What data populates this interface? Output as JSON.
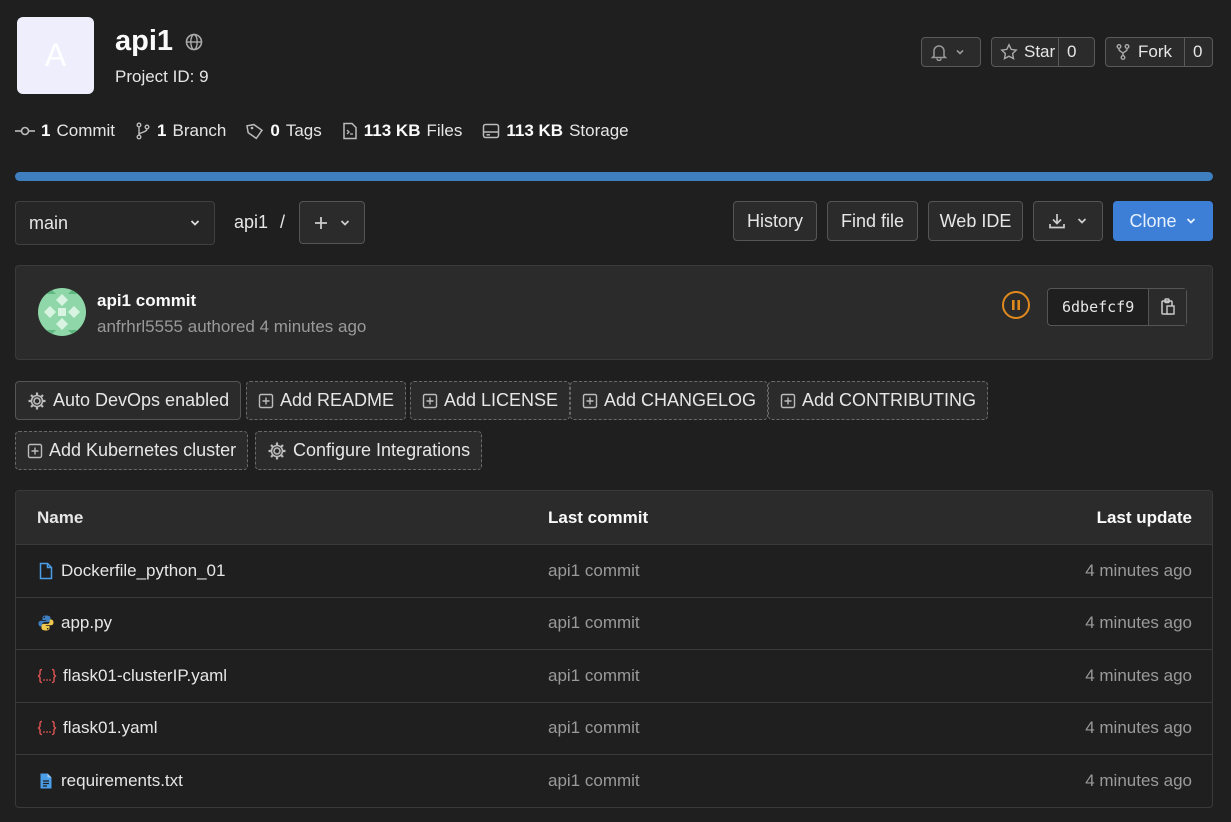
{
  "project": {
    "avatar_letter": "A",
    "name": "api1",
    "visibility_icon": "globe-icon",
    "project_id": "Project ID: 9"
  },
  "header_actions": {
    "notifications_icon": "bell-icon",
    "star_label": "Star",
    "star_count": "0",
    "fork_label": "Fork",
    "fork_count": "0"
  },
  "stats": [
    {
      "icon": "commit-icon",
      "value": "1",
      "label": "Commit"
    },
    {
      "icon": "branch-icon",
      "value": "1",
      "label": "Branch"
    },
    {
      "icon": "tag-icon",
      "value": "0",
      "label": "Tags"
    },
    {
      "icon": "file-icon",
      "value": "113 KB",
      "label": "Files"
    },
    {
      "icon": "storage-icon",
      "value": "113 KB",
      "label": "Storage"
    }
  ],
  "language_bar": {
    "color": "#3f7fbf",
    "fraction": 1.0
  },
  "toolbar": {
    "branch": "main",
    "breadcrumb_repo": "api1",
    "breadcrumb_sep": "/",
    "history_label": "History",
    "find_file_label": "Find file",
    "web_ide_label": "Web IDE",
    "clone_label": "Clone"
  },
  "last_commit": {
    "title": "api1 commit",
    "author": "anfrhrl5555",
    "authored_text": "authored 4 minutes ago",
    "pipeline_status": "paused",
    "sha": "6dbefcf9"
  },
  "quick_actions": [
    {
      "label": "Auto DevOps enabled",
      "icon": "gear-icon"
    },
    {
      "label": "Add README",
      "icon": "plus-square-icon"
    },
    {
      "label": "Add LICENSE",
      "icon": "plus-square-icon"
    },
    {
      "label": "Add CHANGELOG",
      "icon": "plus-square-icon"
    },
    {
      "label": "Add CONTRIBUTING",
      "icon": "plus-square-icon"
    },
    {
      "label": "Add Kubernetes cluster",
      "icon": "plus-square-icon"
    },
    {
      "label": "Configure Integrations",
      "icon": "gear-icon"
    }
  ],
  "file_table": {
    "headers": {
      "name": "Name",
      "last_commit": "Last commit",
      "last_update": "Last update"
    },
    "rows": [
      {
        "name": "Dockerfile_python_01",
        "icon": "file-icon",
        "commit": "api1 commit",
        "updated": "4 minutes ago"
      },
      {
        "name": "app.py",
        "icon": "python-icon",
        "commit": "api1 commit",
        "updated": "4 minutes ago"
      },
      {
        "name": "flask01-clusterIP.yaml",
        "icon": "yaml-icon",
        "commit": "api1 commit",
        "updated": "4 minutes ago"
      },
      {
        "name": "flask01.yaml",
        "icon": "yaml-icon",
        "commit": "api1 commit",
        "updated": "4 minutes ago"
      },
      {
        "name": "requirements.txt",
        "icon": "text-file-icon",
        "commit": "api1 commit",
        "updated": "4 minutes ago"
      }
    ]
  }
}
